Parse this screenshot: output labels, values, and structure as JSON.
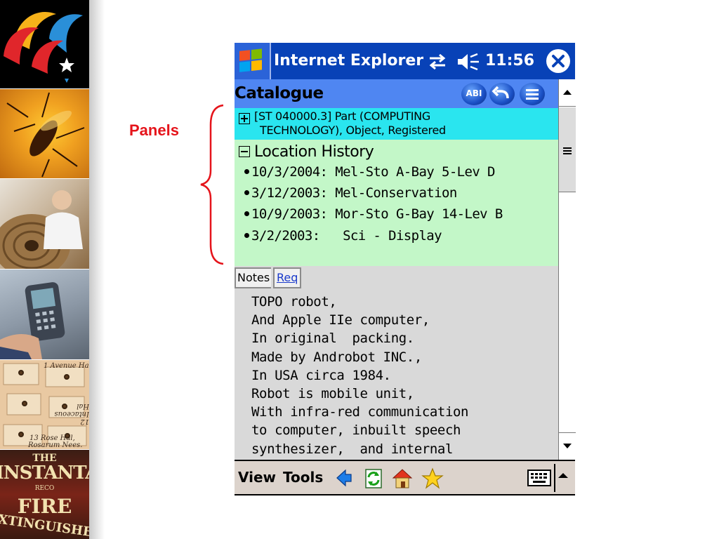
{
  "annotation": {
    "label": "Panels"
  },
  "strip": {
    "postcard_lines": [
      "1 Avenue Ha",
      "12 Intaceous Hal",
      "13 Rose Hal,",
      "Rosarum Nees."
    ],
    "tin_lines": [
      "THE",
      "INSTANTA",
      "RECO",
      "FIRE",
      "EXTINGUISHER"
    ]
  },
  "titlebar": {
    "app_title": "Internet Explorer",
    "time": "11:56"
  },
  "header": {
    "title": "Catalogue",
    "buttons": [
      "ABI",
      "",
      ""
    ]
  },
  "part_panel": {
    "line1": "[ST 040000.3] Part (COMPUTING",
    "line2": "TECHNOLOGY), Object, Registered"
  },
  "location_panel": {
    "title": "Location History",
    "items": [
      "10/3/2004: Mel-Sto A-Bay 5-Lev D",
      "3/12/2003: Mel-Conservation",
      "10/9/2003: Mor-Sto G-Bay 14-Lev B",
      "3/2/2003:   Sci - Display"
    ]
  },
  "tabs": {
    "notes": "Notes",
    "req": "Req"
  },
  "notes": {
    "lines": [
      "TOPO robot,",
      "And Apple IIe computer,",
      "In original  packing.",
      "Made by Androbot INC.,",
      "In USA circa 1984.",
      "Robot is mobile unit,",
      "With infra-red communication",
      "to computer, inbuilt speech",
      "synthesizer,  and internal"
    ]
  },
  "menubar": {
    "view": "View",
    "tools": "Tools"
  },
  "icons": [
    "windows-start-icon",
    "connectivity-icon",
    "speaker-icon",
    "close-icon",
    "back-arrow-icon",
    "refresh-icon",
    "home-icon",
    "favorites-star-icon",
    "keyboard-icon",
    "sip-up-arrow-icon"
  ],
  "colors": {
    "titlebar": "#0842b7",
    "header": "#4f86f2",
    "part_panel": "#2ae5ef",
    "location_panel": "#c3f7c8",
    "annotation": "#e5141b"
  }
}
